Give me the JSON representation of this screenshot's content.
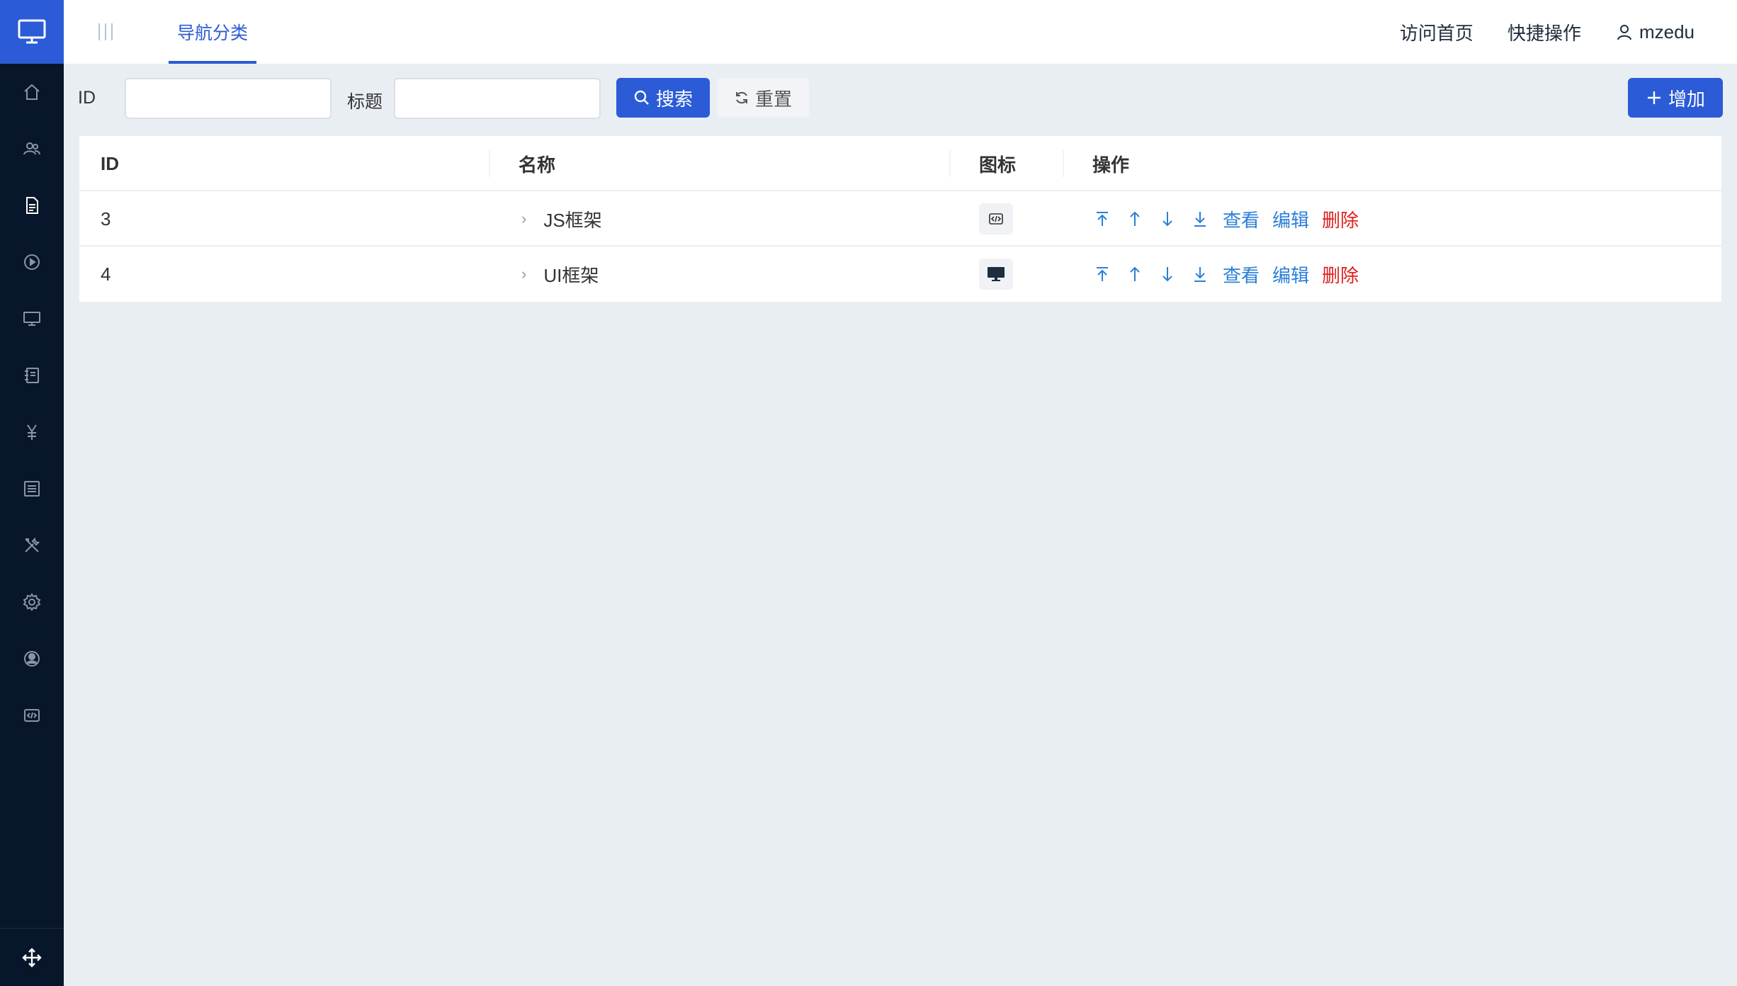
{
  "topbar": {
    "tab": "导航分类",
    "links": [
      "访问首页",
      "快捷操作"
    ],
    "username": "mzedu"
  },
  "search": {
    "id_label": "ID",
    "id_value": "",
    "title_label": "标题",
    "title_value": "",
    "search_button": "搜索",
    "reset_button": "重置",
    "add_button": "增加"
  },
  "table": {
    "headers": [
      "ID",
      "名称",
      "图标",
      "操作"
    ],
    "rows": [
      {
        "id": "3",
        "name": "JS框架",
        "icon": "code-icon"
      },
      {
        "id": "4",
        "name": "UI框架",
        "icon": "monitor-icon"
      }
    ],
    "actions": {
      "view": "查看",
      "edit": "编辑",
      "delete": "删除"
    }
  },
  "sidebar": {
    "icons": [
      "home-icon",
      "users-icon",
      "document-icon",
      "play-icon",
      "monitor-icon",
      "notebook-icon",
      "yen-icon",
      "list-icon",
      "tools-icon",
      "settings-icon",
      "user-circle-icon",
      "code-icon"
    ],
    "active": "document-icon"
  },
  "colors": {
    "primary": "#2b5bd6",
    "sidebar": "#08162b",
    "link": "#2b7fd6",
    "danger": "#e02020"
  }
}
